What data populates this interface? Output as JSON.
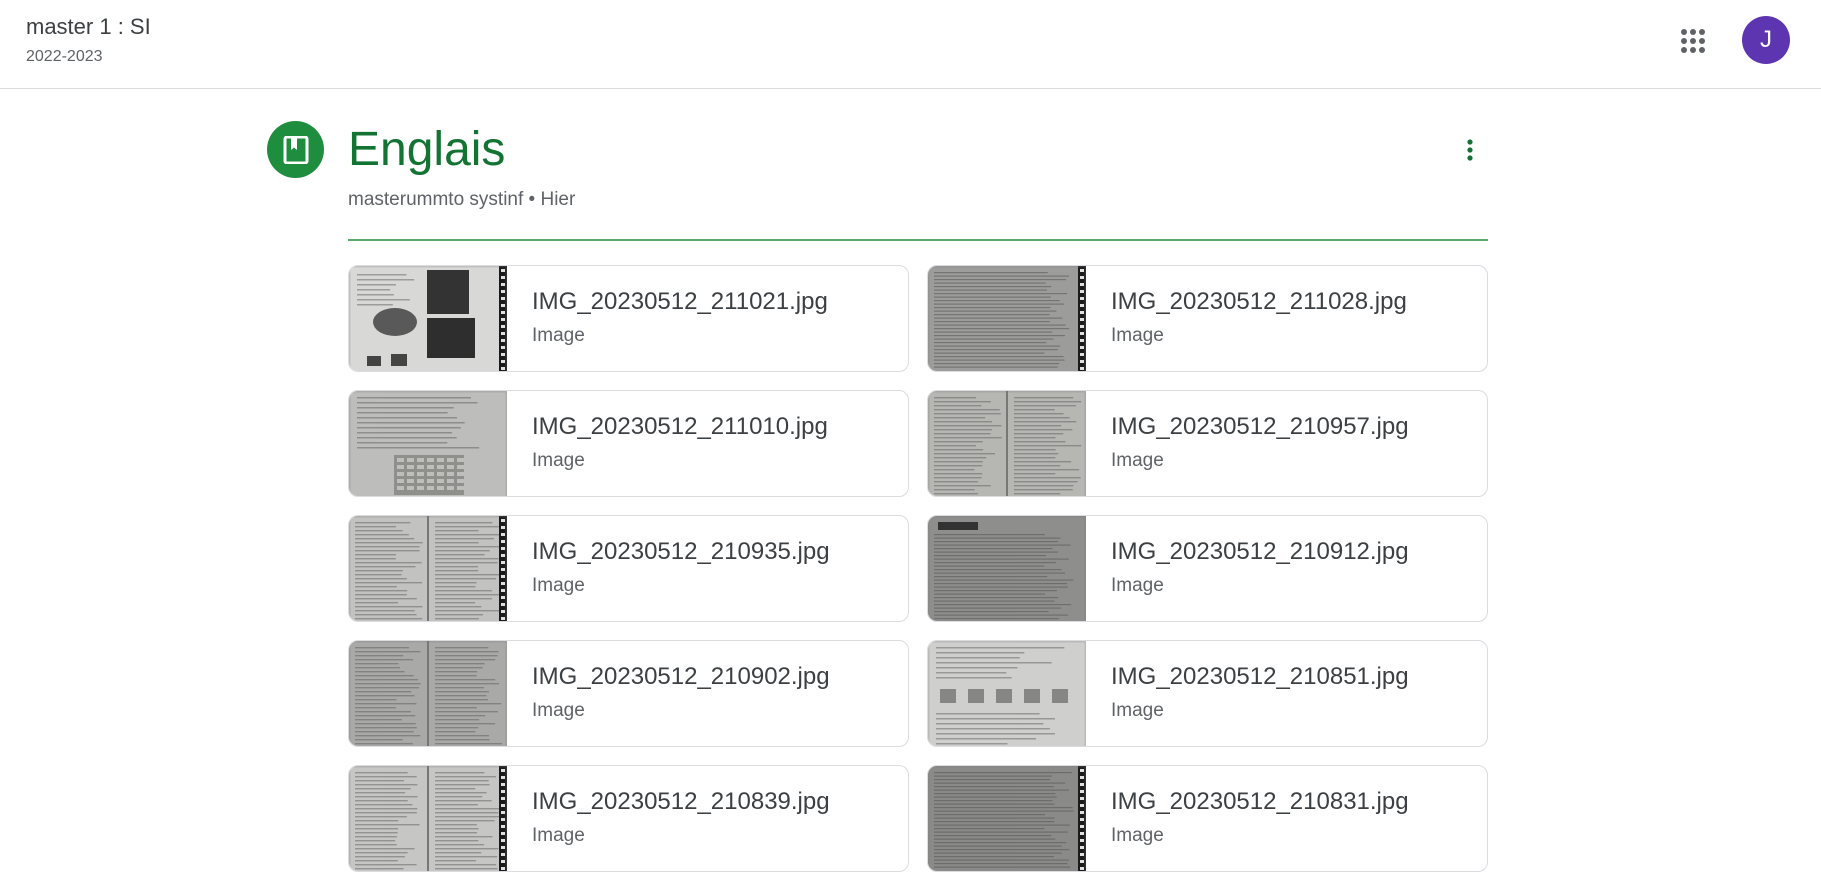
{
  "header": {
    "class_title": "master 1 : SI",
    "class_subtitle": "2022-2023",
    "apps_icon": "apps-grid-icon",
    "avatar_initial": "J",
    "avatar_color": "#5e35b1"
  },
  "post": {
    "icon": "bookmark-icon",
    "title": "Englais",
    "meta": "masterummto systinf • Hier",
    "accent_color": "#137333",
    "more_icon": "more-vert-icon"
  },
  "attachments": [
    {
      "name": "IMG_20230512_211021.jpg",
      "type": "Image"
    },
    {
      "name": "IMG_20230512_211028.jpg",
      "type": "Image"
    },
    {
      "name": "IMG_20230512_211010.jpg",
      "type": "Image"
    },
    {
      "name": "IMG_20230512_210957.jpg",
      "type": "Image"
    },
    {
      "name": "IMG_20230512_210935.jpg",
      "type": "Image"
    },
    {
      "name": "IMG_20230512_210912.jpg",
      "type": "Image"
    },
    {
      "name": "IMG_20230512_210902.jpg",
      "type": "Image"
    },
    {
      "name": "IMG_20230512_210851.jpg",
      "type": "Image"
    },
    {
      "name": "IMG_20230512_210839.jpg",
      "type": "Image"
    },
    {
      "name": "IMG_20230512_210831.jpg",
      "type": "Image"
    }
  ]
}
